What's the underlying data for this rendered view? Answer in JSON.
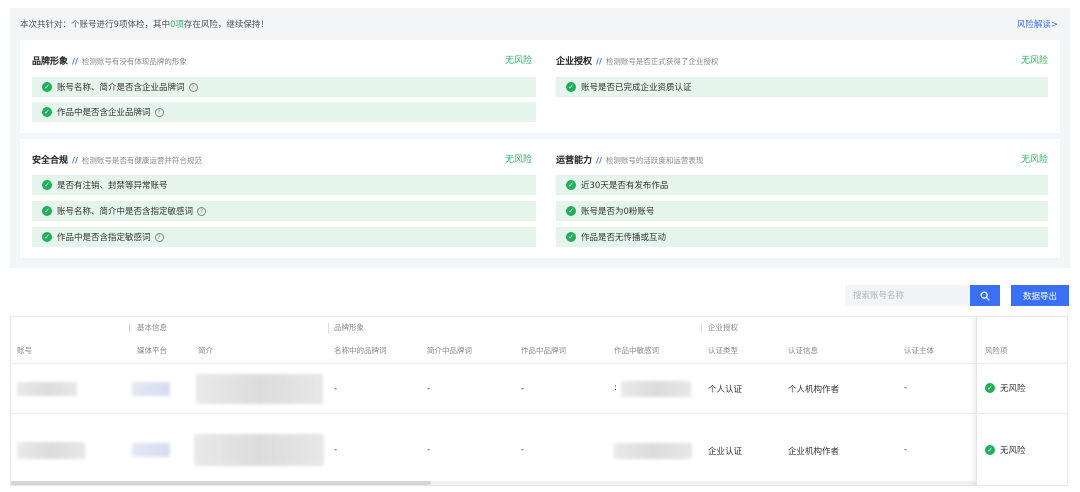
{
  "summary": {
    "prefix": "本次共针对",
    "middle": "个账号进行9项体检，其中",
    "count": "0项",
    "suffix": "存在风险，继续保持！"
  },
  "risk_link": "风险解读>",
  "cards": {
    "brand": {
      "title": "品牌形象",
      "sep": "//",
      "desc": "检测账号有没有体现品牌的形象",
      "status": "无风险",
      "items": [
        "账号名称、简介是否含企业品牌词",
        "作品中是否含企业品牌词"
      ]
    },
    "auth": {
      "title": "企业授权",
      "sep": "//",
      "desc": "检测账号是否正式获得了企业授权",
      "status": "无风险",
      "items": [
        "账号是否已完成企业资质认证"
      ]
    },
    "safety": {
      "title": "安全合规",
      "sep": "//",
      "desc": "检测账号是否有健康运营并符合规范",
      "status": "无风险",
      "items": [
        "是否有注销、封禁等异常账号",
        "账号名称、简介中是否含指定敏感词",
        "作品中是否含指定敏感词"
      ]
    },
    "ops": {
      "title": "运营能力",
      "sep": "//",
      "desc": "检测账号的活跃度和运营表现",
      "status": "无风险",
      "items": [
        "近30天是否有发布作品",
        "账号是否为0粉账号",
        "作品是否无传播或互动"
      ]
    }
  },
  "toolbar": {
    "search_placeholder": "搜索账号名称",
    "export_label": "数据导出"
  },
  "table": {
    "groups": [
      "基本信息",
      "品牌形象",
      "企业授权"
    ],
    "columns": [
      "账号",
      "媒体平台",
      "简介",
      "名称中的品牌词",
      "简介中品牌词",
      "作品中品牌词",
      "作品中敏感词",
      "认证类型",
      "认证信息",
      "认证主体",
      "风险项"
    ],
    "rows": [
      {
        "name_brand": "-",
        "intro_brand": "-",
        "works_brand": "-",
        "works_sensitive": ":",
        "cert_type": "个人认证",
        "cert_info": "个人机构作者",
        "cert_subject": "-",
        "risk": "无风险"
      },
      {
        "name_brand": "-",
        "intro_brand": "-",
        "works_brand": "-",
        "works_sensitive": "",
        "cert_type": "企业认证",
        "cert_info": "企业机构作者",
        "cert_subject": "-",
        "risk": "无风险"
      }
    ]
  },
  "icons": {
    "check": "✓",
    "help": "?"
  },
  "colors": {
    "accent": "#3b6ff5",
    "success": "#28b463",
    "success_bg": "#e6f5ec"
  }
}
